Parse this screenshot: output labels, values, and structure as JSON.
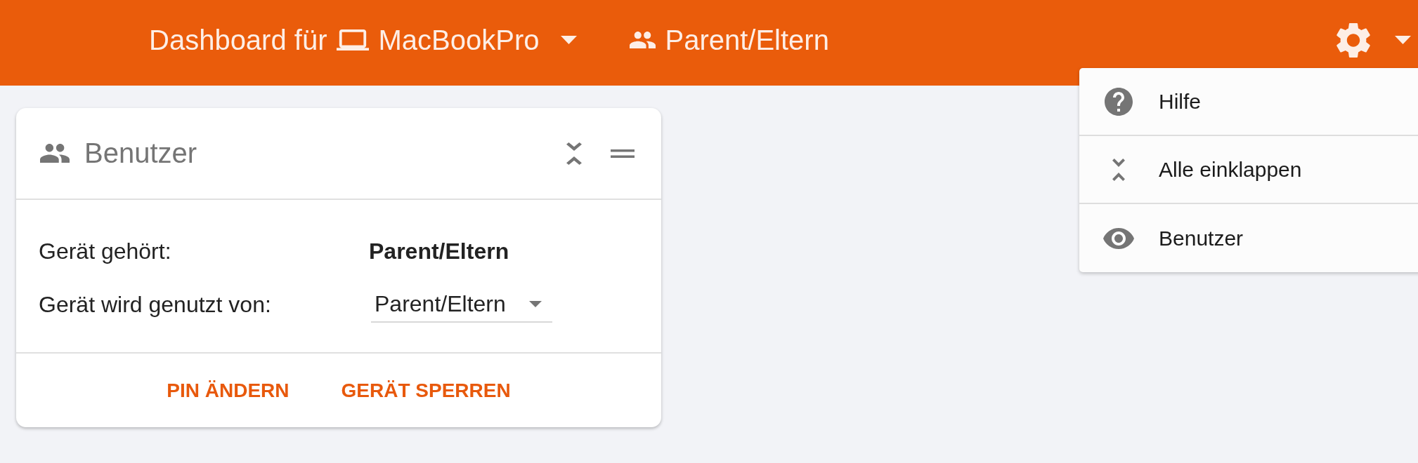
{
  "header": {
    "title": "Dashboard für",
    "device": "MacBookPro",
    "user": "Parent/Eltern"
  },
  "settings_menu": {
    "expanded": true,
    "items": [
      {
        "kind": "help",
        "label": "Hilfe"
      },
      {
        "kind": "collapse",
        "label": "Alle einklappen"
      },
      {
        "kind": "widget",
        "label": "Benutzer",
        "visible": true
      }
    ]
  },
  "card": {
    "title": "Benutzer",
    "rows": [
      {
        "kind": "text",
        "label": "Gerät gehört:",
        "value": "Parent/Eltern"
      },
      {
        "kind": "select",
        "label": "Gerät wird genutzt von:",
        "value": "Parent/Eltern"
      }
    ],
    "actions": [
      "PIN ÄNDERN",
      "GERÄT SPERREN"
    ]
  }
}
